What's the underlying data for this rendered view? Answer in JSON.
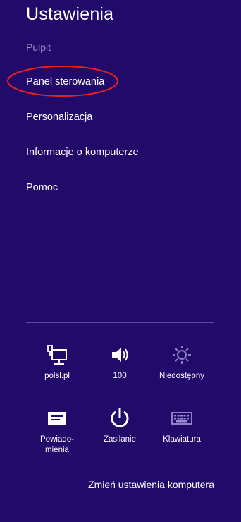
{
  "header": {
    "title": "Ustawienia",
    "subtitle": "Pulpit"
  },
  "menu": {
    "items": [
      {
        "label": "Panel sterowania",
        "highlighted": true
      },
      {
        "label": "Personalizacja"
      },
      {
        "label": "Informacje o komputerze"
      },
      {
        "label": "Pomoc"
      }
    ]
  },
  "quick_settings": {
    "network": {
      "label": "polsl.pl",
      "icon": "network-icon"
    },
    "volume": {
      "label": "100",
      "icon": "speaker-icon"
    },
    "brightness": {
      "label": "Niedostępny",
      "icon": "brightness-icon"
    },
    "notifications": {
      "label": "Powiado-\nmienia",
      "icon": "notifications-icon"
    },
    "power": {
      "label": "Zasilanie",
      "icon": "power-icon"
    },
    "keyboard": {
      "label": "Klawiatura",
      "icon": "keyboard-icon"
    }
  },
  "footer": {
    "change_settings": "Zmień ustawienia komputera"
  },
  "colors": {
    "background": "#210a6a",
    "highlight": "#e8201f",
    "muted": "#9a8fc9"
  }
}
